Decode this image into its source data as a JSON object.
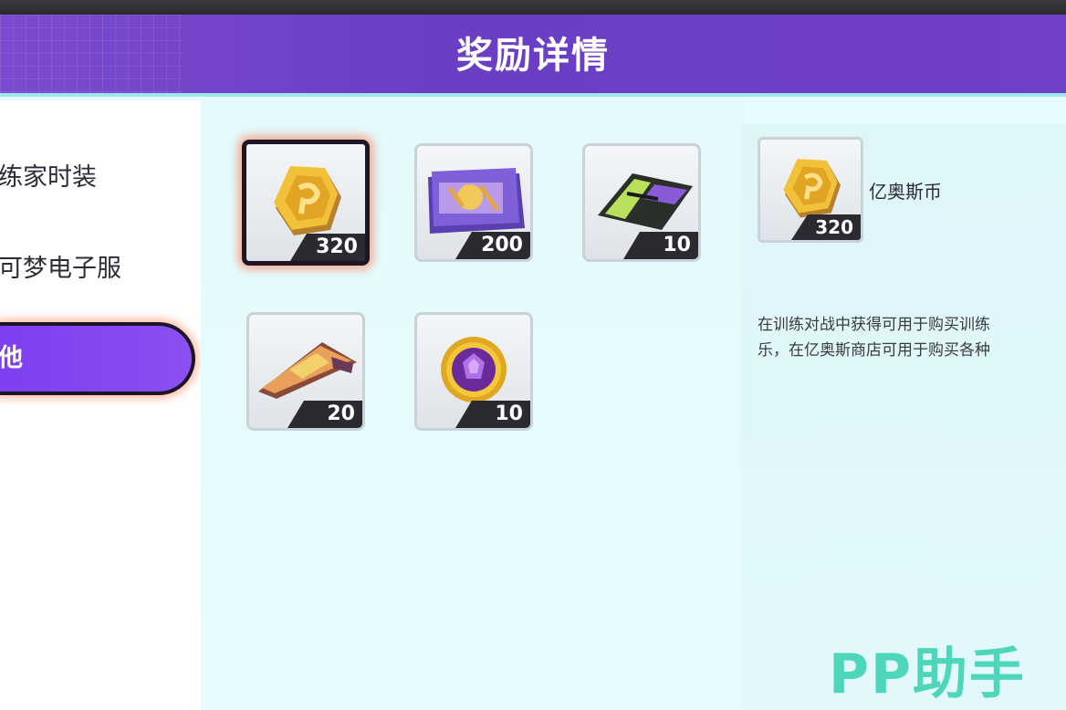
{
  "header": {
    "title": "奖励详情"
  },
  "sidebar": {
    "items": [
      {
        "label": "练家时装"
      },
      {
        "label": "可梦电子服"
      },
      {
        "label": "他"
      }
    ]
  },
  "rewards": [
    {
      "icon": "coin-icon",
      "count": "320"
    },
    {
      "icon": "ticket-icon",
      "count": "200"
    },
    {
      "icon": "card-icon",
      "count": "10"
    },
    {
      "icon": "food-icon",
      "count": "20"
    },
    {
      "icon": "gem-medal-icon",
      "count": "10"
    }
  ],
  "detail": {
    "icon": "coin-icon",
    "count": "320",
    "name": "亿奥斯币",
    "description_lines": [
      "在训练对战中获得可用于购买训练",
      "乐，在亿奥斯商店可用于购买各种"
    ]
  },
  "watermark": {
    "text": "PP助手"
  },
  "colors": {
    "header": "#6f40c8",
    "active_tab": "#7d3ff0",
    "watermark": "#3dd3b2"
  }
}
